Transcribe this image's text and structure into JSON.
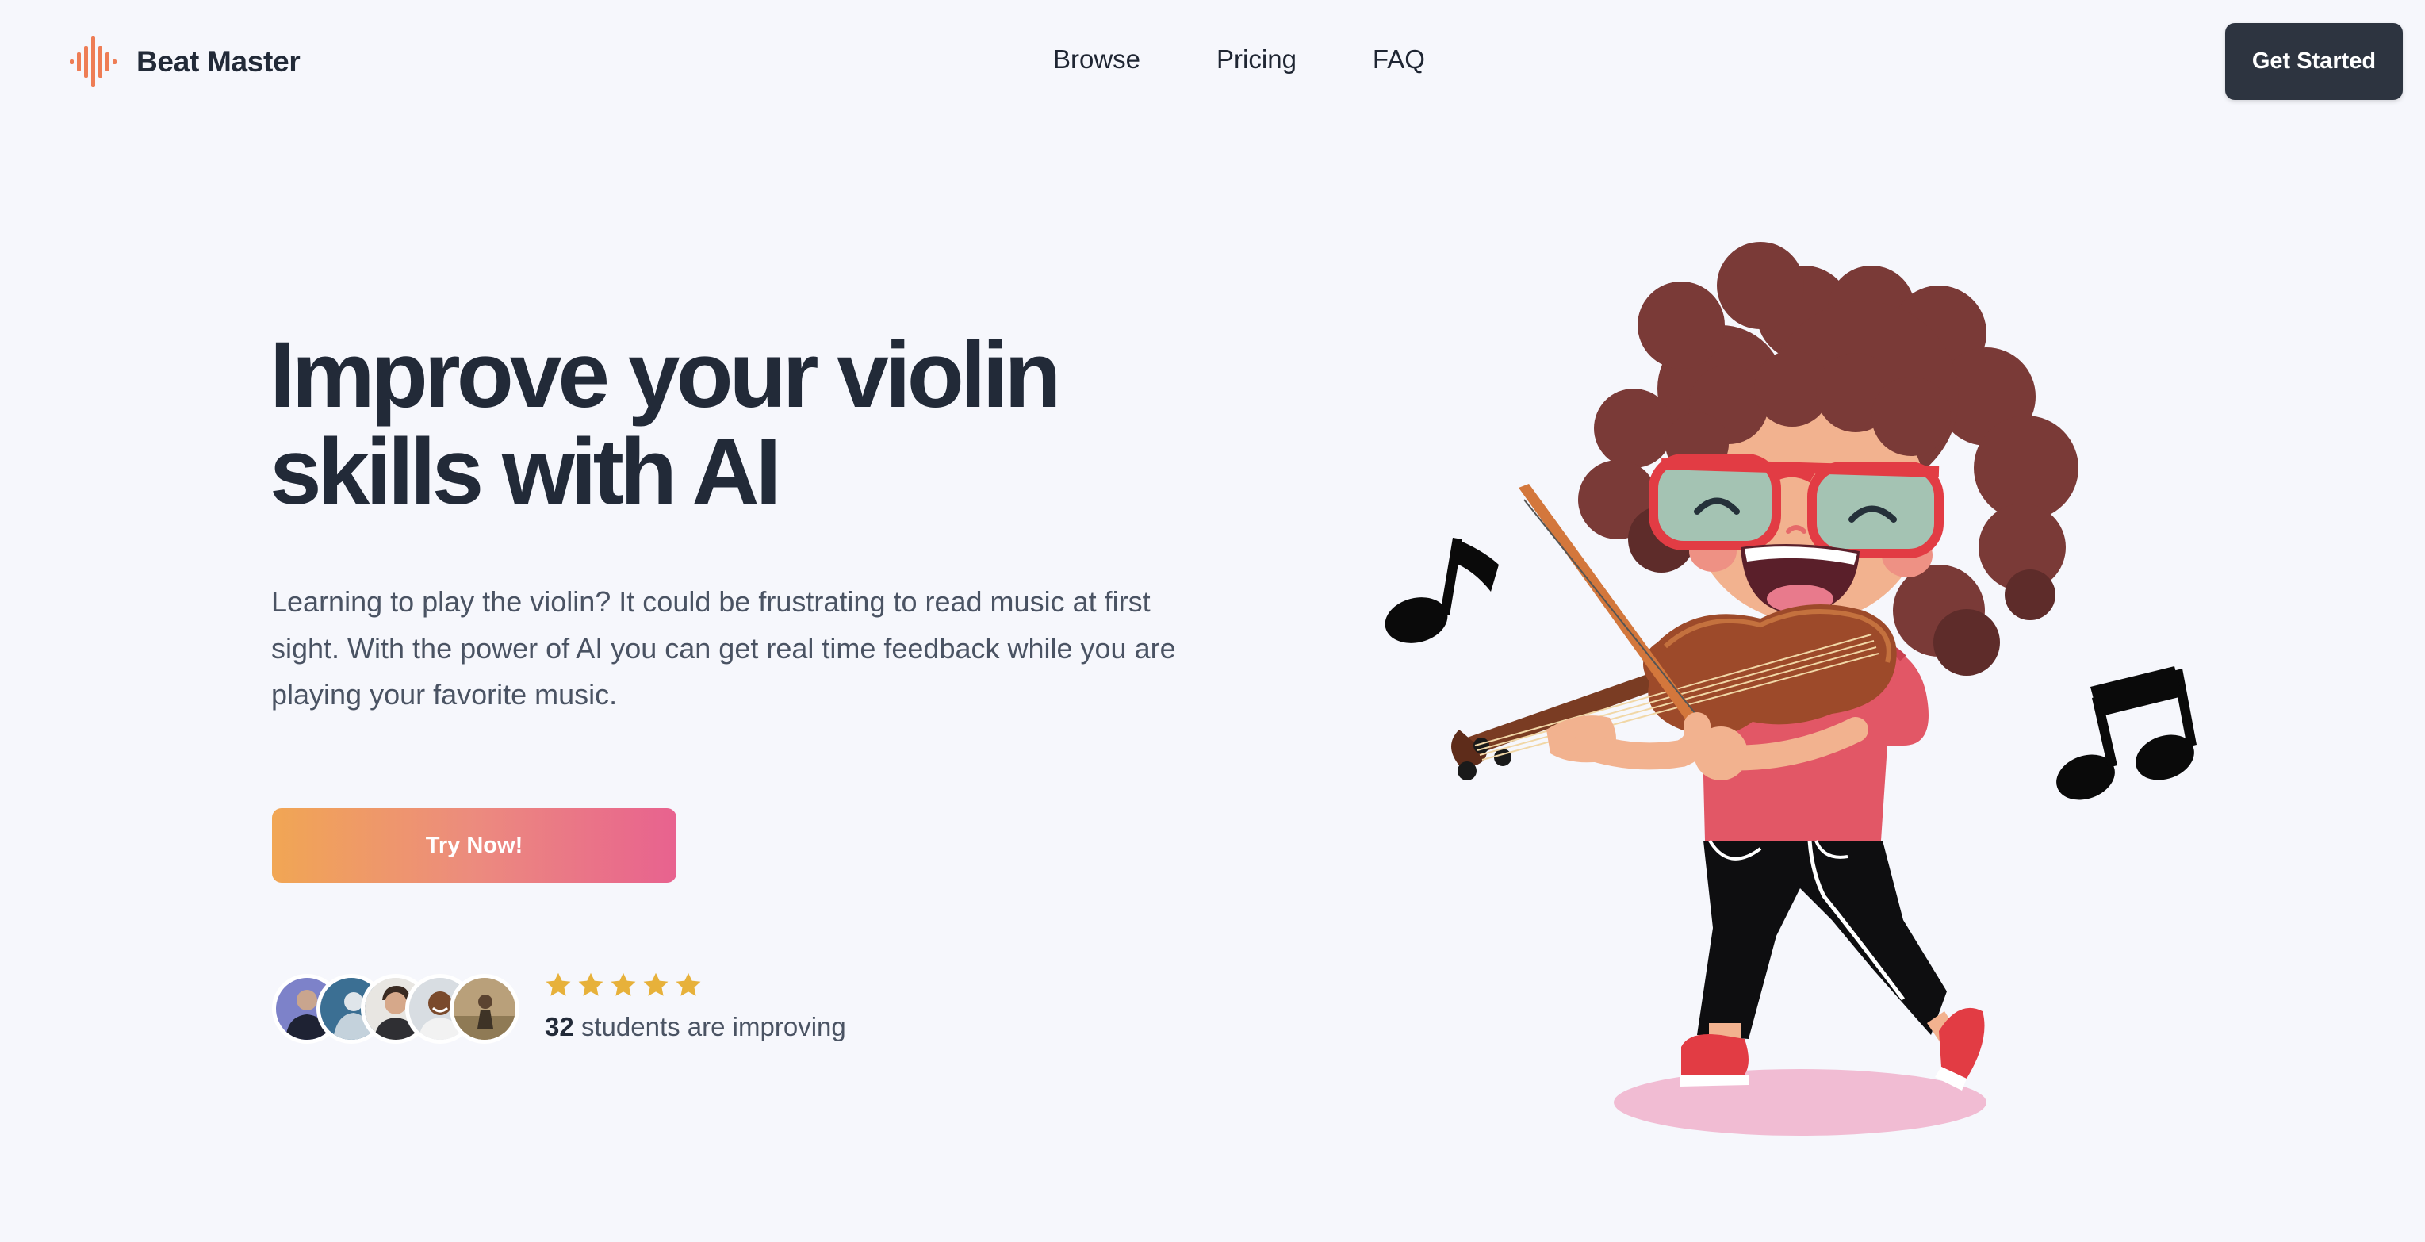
{
  "brand": {
    "name": "Beat Master",
    "logo_icon": "sound-wave-icon",
    "logo_color": "#ee7d55"
  },
  "nav": {
    "links": [
      "Browse",
      "Pricing",
      "FAQ"
    ],
    "cta_label": "Get Started"
  },
  "hero": {
    "title_line1": "Improve your violin",
    "title_line2": "skills with AI",
    "description": "Learning to play the violin? It could be frustrating to read music at first sight. With the power of AI you can get real time feedback while you are playing your favorite music.",
    "cta_label": "Try Now!",
    "cta_gradient": [
      "#f1a654",
      "#e8628f"
    ]
  },
  "social_proof": {
    "rating_stars": 5,
    "star_color": "#e7b13a",
    "count": "32",
    "text": "students are improving",
    "avatars": [
      "avatar-1",
      "avatar-2",
      "avatar-3",
      "avatar-4",
      "avatar-5"
    ]
  },
  "illustration": {
    "subject": "child-playing-violin-illustration",
    "icons": [
      "music-note-icon",
      "beamed-notes-icon"
    ]
  },
  "colors": {
    "background": "#f6f7fc",
    "text_primary": "#222a38",
    "text_secondary": "#4a5363",
    "button_dark": "#2d3440"
  }
}
